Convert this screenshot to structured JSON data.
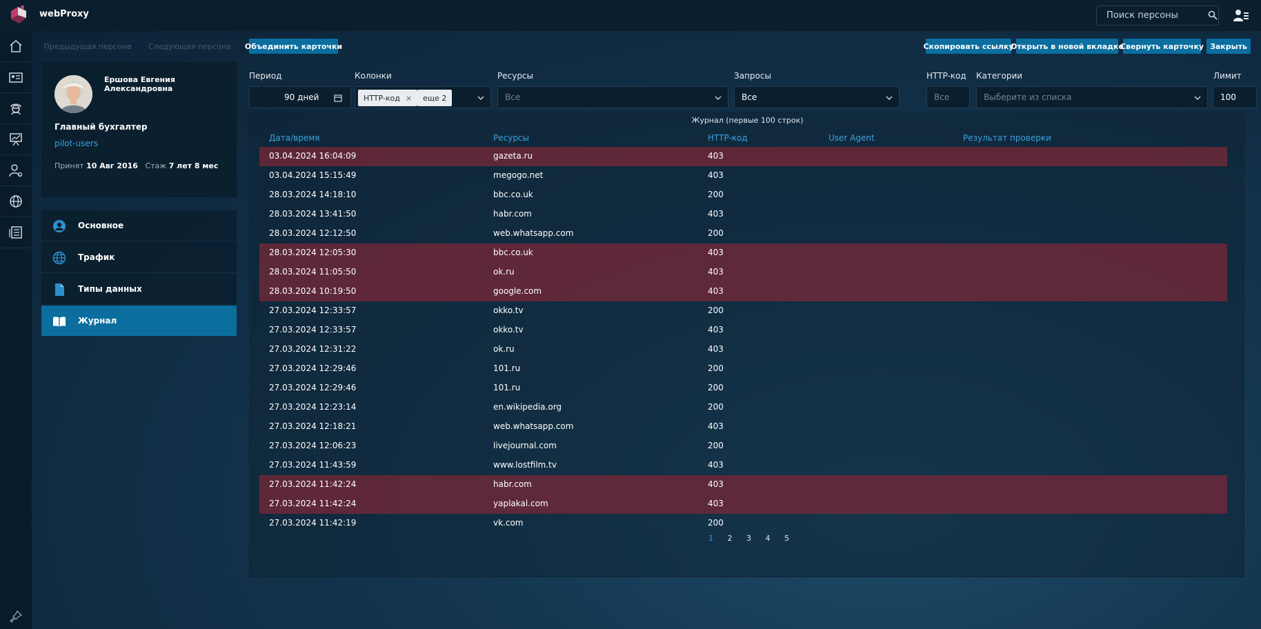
{
  "app": {
    "title": "webProxy"
  },
  "header": {
    "search_placeholder": "Поиск персоны"
  },
  "toolbar": {
    "prev_person": "Предыдущая персона",
    "next_person": "Следующая персона",
    "merge_cards": "Объединить карточки",
    "copy_link": "Скопировать ссылку",
    "open_new_tab": "Открыть в новой вкладке",
    "collapse_card": "Свернуть карточку",
    "close": "Закрыть"
  },
  "profile": {
    "name": "Ершова Евгения Александровна",
    "role": "Главный бухгалтер",
    "group": "pilot-users",
    "hired_label": "Принят",
    "hired_date": "10 Авг 2016",
    "tenure_label": "Стаж",
    "tenure_value": "7 лет 8 мес"
  },
  "nav": {
    "items": [
      {
        "label": "Основное",
        "icon": "user-circle-icon"
      },
      {
        "label": "Трафик",
        "icon": "globe-icon"
      },
      {
        "label": "Типы данных",
        "icon": "document-icon"
      },
      {
        "label": "Журнал",
        "icon": "book-icon",
        "active": true
      }
    ]
  },
  "filters": {
    "period": {
      "label": "Период",
      "value": "90 дней"
    },
    "columns": {
      "label": "Колонки",
      "chip": "HTTP-код",
      "more": "еще 2"
    },
    "resources": {
      "label": "Ресурсы",
      "placeholder": "Все"
    },
    "requests": {
      "label": "Запросы",
      "value": "Все"
    },
    "http_code": {
      "label": "HTTP-код",
      "placeholder": "Все"
    },
    "categories": {
      "label": "Категории",
      "placeholder": "Выберите из списка"
    },
    "limit": {
      "label": "Лимит",
      "value": "100"
    }
  },
  "journal": {
    "title": "Журнал (первые 100 строк)",
    "headers": {
      "datetime": "Дата/время",
      "resources": "Ресурсы",
      "http_code": "HTTP-код",
      "user_agent": "User Agent",
      "check_result": "Результат проверки"
    },
    "rows": [
      {
        "datetime": "03.04.2024 16:04:09",
        "resource": "gazeta.ru",
        "code": "403",
        "blocked": true
      },
      {
        "datetime": "03.04.2024 15:15:49",
        "resource": "megogo.net",
        "code": "403",
        "blocked": false
      },
      {
        "datetime": "28.03.2024 14:18:10",
        "resource": "bbc.co.uk",
        "code": "200",
        "blocked": false
      },
      {
        "datetime": "28.03.2024 13:41:50",
        "resource": "habr.com",
        "code": "403",
        "blocked": false
      },
      {
        "datetime": "28.03.2024 12:12:50",
        "resource": "web.whatsapp.com",
        "code": "200",
        "blocked": false
      },
      {
        "datetime": "28.03.2024 12:05:30",
        "resource": "bbc.co.uk",
        "code": "403",
        "blocked": true
      },
      {
        "datetime": "28.03.2024 11:05:50",
        "resource": "ok.ru",
        "code": "403",
        "blocked": true
      },
      {
        "datetime": "28.03.2024 10:19:50",
        "resource": "google.com",
        "code": "403",
        "blocked": true
      },
      {
        "datetime": "27.03.2024 12:33:57",
        "resource": "okko.tv",
        "code": "200",
        "blocked": false
      },
      {
        "datetime": "27.03.2024 12:33:57",
        "resource": "okko.tv",
        "code": "403",
        "blocked": false
      },
      {
        "datetime": "27.03.2024 12:31:22",
        "resource": "ok.ru",
        "code": "403",
        "blocked": false
      },
      {
        "datetime": "27.03.2024 12:29:46",
        "resource": "101.ru",
        "code": "200",
        "blocked": false
      },
      {
        "datetime": "27.03.2024 12:29:46",
        "resource": "101.ru",
        "code": "200",
        "blocked": false
      },
      {
        "datetime": "27.03.2024 12:23:14",
        "resource": "en.wikipedia.org",
        "code": "200",
        "blocked": false
      },
      {
        "datetime": "27.03.2024 12:18:21",
        "resource": "web.whatsapp.com",
        "code": "403",
        "blocked": false
      },
      {
        "datetime": "27.03.2024 12:06:23",
        "resource": "livejournal.com",
        "code": "200",
        "blocked": false
      },
      {
        "datetime": "27.03.2024 11:43:59",
        "resource": "www.lostfilm.tv",
        "code": "403",
        "blocked": false
      },
      {
        "datetime": "27.03.2024 11:42:24",
        "resource": "habr.com",
        "code": "403",
        "blocked": true
      },
      {
        "datetime": "27.03.2024 11:42:24",
        "resource": "yaplakal.com",
        "code": "403",
        "blocked": true
      },
      {
        "datetime": "27.03.2024 11:42:19",
        "resource": "vk.com",
        "code": "200",
        "blocked": false
      }
    ],
    "pages": [
      "1",
      "2",
      "3",
      "4",
      "5"
    ],
    "current_page": "1"
  },
  "colors": {
    "accent": "#0b6e9f",
    "link": "#3aa3e0",
    "blocked_row": "#78283a"
  }
}
